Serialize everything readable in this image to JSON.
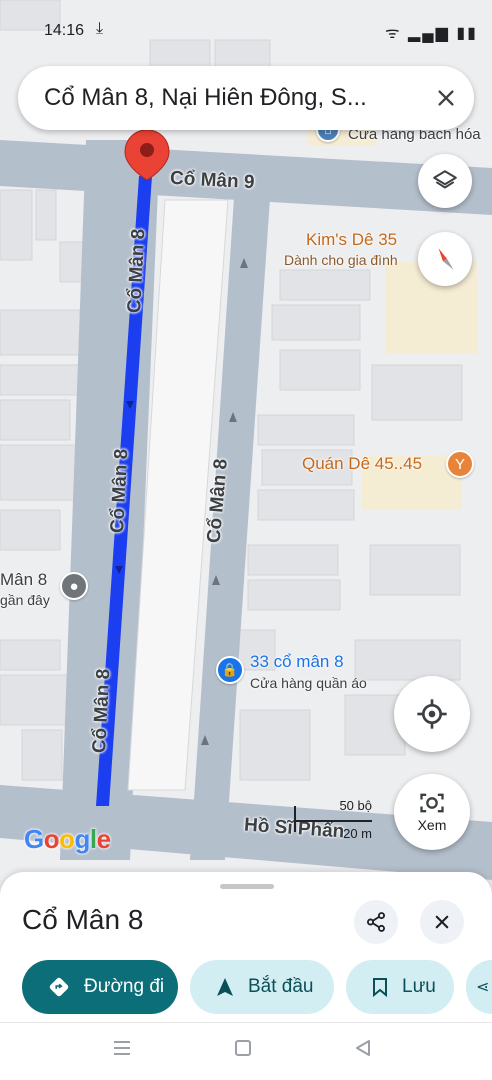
{
  "status_bar": {
    "time": "14:16",
    "icons": "ᯤ ▂▄▆ ▮▮"
  },
  "search": {
    "query": "Cổ Mân 8, Nại Hiên Đông, S..."
  },
  "map": {
    "roads": {
      "road_top": "Cổ Mân 9",
      "selected_upper": "Cổ Mân 8",
      "selected_lower_a": "Cổ Mân 8",
      "selected_lower_b": "Cổ Mân 8",
      "middle": "Cổ Mân 8",
      "bottom": "Hồ Sĩ Phấn"
    },
    "pois": {
      "store_top": {
        "name": "Cửa hàng bách hóa"
      },
      "kims": {
        "name": "Kim's Dê 35",
        "sub": "Dành cho gia đình"
      },
      "quan_de": {
        "name": "Quán Dê 45..45"
      },
      "left_place": {
        "name": "Mân 8",
        "sub": "gần đây"
      },
      "clothing": {
        "name": "33 cổ mân 8",
        "sub": "Cửa hàng quần áo"
      }
    },
    "watermark": "Google",
    "scale": {
      "imperial": "50 bộ",
      "metric": "20 m"
    },
    "layers_icon": "layers-icon",
    "compass_icon": "compass-icon",
    "location_icon": "my-location-icon",
    "lens_button_label": "Xem",
    "accent": "#1a3ef0",
    "pin_color": "#ea4335"
  },
  "sheet": {
    "title": "Cổ Mân 8",
    "buttons": {
      "directions": "Đường đi",
      "start": "Bắt đầu",
      "save": "Lưu"
    }
  }
}
